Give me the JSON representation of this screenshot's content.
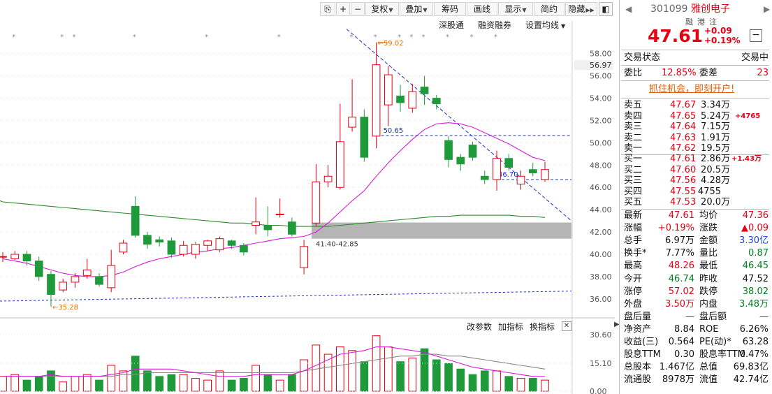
{
  "toolbar": {
    "buttons": [
      {
        "label": "复权",
        "dropdown": true
      },
      {
        "label": "叠加",
        "dropdown": true
      },
      {
        "label": "筹码",
        "dropdown": false
      },
      {
        "label": "画线",
        "dropdown": false
      },
      {
        "label": "显示",
        "dropdown": true
      },
      {
        "label": "简约",
        "dropdown": false
      },
      {
        "label": "隐藏",
        "dropdown": false
      }
    ],
    "shenzhen_link": "深股通",
    "margin_link": "融资融券",
    "ma_settings": "设置均线"
  },
  "price_axis": {
    "ticks": [
      "58.00",
      "56.00",
      "54.00",
      "52.00",
      "50.00",
      "48.00",
      "46.00",
      "44.00",
      "42.00",
      "40.00",
      "38.00",
      "36.00"
    ],
    "current_marker": "56.97"
  },
  "annotations": {
    "high_label": "59.02",
    "low_label": "35.28",
    "line_label_1": "50.65",
    "line_label_2": "46.70",
    "zone_label": "41.40-42.85"
  },
  "volume": {
    "params_link": "改参数",
    "add_indicator": "加指标",
    "switch_indicator": "换指标",
    "close": "✕",
    "axis_ticks": [
      "30.60",
      "15.10",
      "0.00"
    ]
  },
  "chart_data": {
    "type": "candlestick",
    "price_range": [
      35,
      59
    ],
    "volume_range": [
      0,
      31
    ],
    "candles": [
      {
        "o": 39.8,
        "c": 39.8,
        "h": 40.2,
        "l": 39.3,
        "v": 8
      },
      {
        "o": 39.6,
        "c": 40.0,
        "h": 40.3,
        "l": 39.5,
        "v": 9
      },
      {
        "o": 40.0,
        "c": 39.4,
        "h": 40.3,
        "l": 39.0,
        "v": 6
      },
      {
        "o": 39.4,
        "c": 38.0,
        "h": 39.8,
        "l": 37.6,
        "v": 8
      },
      {
        "o": 38.2,
        "c": 36.4,
        "h": 38.5,
        "l": 35.3,
        "v": 11
      },
      {
        "o": 36.8,
        "c": 37.5,
        "h": 37.8,
        "l": 36.6,
        "v": 5
      },
      {
        "o": 37.5,
        "c": 38.0,
        "h": 38.3,
        "l": 37.0,
        "v": 8
      },
      {
        "o": 38.1,
        "c": 38.6,
        "h": 39.6,
        "l": 37.8,
        "v": 9
      },
      {
        "o": 38.0,
        "c": 37.3,
        "h": 38.3,
        "l": 37.1,
        "v": 6
      },
      {
        "o": 37.0,
        "c": 39.0,
        "h": 40.4,
        "l": 36.6,
        "v": 14
      },
      {
        "o": 40.2,
        "c": 41.0,
        "h": 41.3,
        "l": 40.0,
        "v": 11
      },
      {
        "o": 44.3,
        "c": 41.7,
        "h": 45.2,
        "l": 41.5,
        "v": 19
      },
      {
        "o": 41.7,
        "c": 40.9,
        "h": 42.0,
        "l": 40.5,
        "v": 11
      },
      {
        "o": 41.3,
        "c": 41.1,
        "h": 41.6,
        "l": 40.7,
        "v": 8
      },
      {
        "o": 41.2,
        "c": 40.0,
        "h": 41.5,
        "l": 39.7,
        "v": 9
      },
      {
        "o": 40.0,
        "c": 40.8,
        "h": 41.2,
        "l": 39.8,
        "v": 9
      },
      {
        "o": 40.0,
        "c": 40.9,
        "h": 41.1,
        "l": 39.6,
        "v": 7
      },
      {
        "o": 40.8,
        "c": 41.2,
        "h": 41.3,
        "l": 40.3,
        "v": 6
      },
      {
        "o": 40.4,
        "c": 41.4,
        "h": 41.6,
        "l": 40.2,
        "v": 11
      },
      {
        "o": 41.2,
        "c": 40.8,
        "h": 41.3,
        "l": 40.5,
        "v": 6
      },
      {
        "o": 40.8,
        "c": 40.2,
        "h": 41.0,
        "l": 39.9,
        "v": 7
      },
      {
        "o": 42.6,
        "c": 42.9,
        "h": 45.1,
        "l": 41.8,
        "v": 14
      },
      {
        "o": 42.6,
        "c": 42.2,
        "h": 44.3,
        "l": 41.6,
        "v": 9
      },
      {
        "o": 43.6,
        "c": 43.6,
        "h": 45.0,
        "l": 43.3,
        "v": 6
      },
      {
        "o": 42.9,
        "c": 41.8,
        "h": 43.3,
        "l": 41.6,
        "v": 9
      },
      {
        "o": 38.8,
        "c": 40.7,
        "h": 41.3,
        "l": 38.2,
        "v": 17
      },
      {
        "o": 42.8,
        "c": 46.5,
        "h": 48.1,
        "l": 42.5,
        "v": 25
      },
      {
        "o": 46.5,
        "c": 47.0,
        "h": 48.0,
        "l": 46.0,
        "v": 20
      },
      {
        "o": 46.0,
        "c": 50.1,
        "h": 53.5,
        "l": 45.8,
        "v": 24
      },
      {
        "o": 51.4,
        "c": 52.3,
        "h": 55.7,
        "l": 51.0,
        "v": 22
      },
      {
        "o": 52.3,
        "c": 48.7,
        "h": 53.0,
        "l": 48.3,
        "v": 16
      },
      {
        "o": 50.6,
        "c": 57.0,
        "h": 59.0,
        "l": 49.5,
        "v": 30
      },
      {
        "o": 53.4,
        "c": 56.1,
        "h": 56.9,
        "l": 51.5,
        "v": 24
      },
      {
        "o": 54.2,
        "c": 53.6,
        "h": 55.2,
        "l": 52.8,
        "v": 16
      },
      {
        "o": 53.1,
        "c": 54.6,
        "h": 55.3,
        "l": 52.7,
        "v": 18
      },
      {
        "o": 55.0,
        "c": 54.4,
        "h": 56.0,
        "l": 53.4,
        "v": 23
      },
      {
        "o": 54.0,
        "c": 53.5,
        "h": 54.3,
        "l": 53.0,
        "v": 17
      },
      {
        "o": 50.2,
        "c": 48.5,
        "h": 50.6,
        "l": 47.8,
        "v": 15
      },
      {
        "o": 48.7,
        "c": 48.1,
        "h": 49.0,
        "l": 47.5,
        "v": 12
      },
      {
        "o": 49.8,
        "c": 48.7,
        "h": 50.1,
        "l": 48.4,
        "v": 9
      },
      {
        "o": 47.0,
        "c": 46.7,
        "h": 47.5,
        "l": 46.3,
        "v": 11
      },
      {
        "o": 46.7,
        "c": 48.6,
        "h": 49.3,
        "l": 45.7,
        "v": 11
      },
      {
        "o": 48.6,
        "c": 47.8,
        "h": 49.0,
        "l": 47.5,
        "v": 8
      },
      {
        "o": 46.3,
        "c": 47.0,
        "h": 47.5,
        "l": 45.8,
        "v": 7
      },
      {
        "o": 47.6,
        "c": 47.3,
        "h": 48.2,
        "l": 47.0,
        "v": 7
      },
      {
        "o": 46.7,
        "c": 47.6,
        "h": 48.3,
        "l": 46.5,
        "v": 6
      }
    ],
    "ma_short": [
      39.6,
      39.4,
      39.2,
      38.9,
      38.6,
      38.3,
      38.1,
      38.0,
      38.0,
      38.1,
      38.4,
      38.9,
      39.3,
      39.6,
      39.8,
      40.0,
      40.2,
      40.3,
      40.5,
      40.6,
      40.8,
      41.0,
      41.2,
      41.4,
      41.5,
      41.6,
      42.0,
      42.8,
      43.8,
      44.8,
      45.7,
      47.0,
      48.2,
      49.3,
      50.3,
      51.2,
      51.7,
      51.8,
      51.7,
      51.4,
      50.9,
      50.4,
      49.9,
      49.3,
      48.7,
      48.4
    ],
    "ma_long": [
      44.7,
      44.6,
      44.5,
      44.4,
      44.3,
      44.2,
      44.1,
      44.0,
      43.9,
      43.8,
      43.7,
      43.6,
      43.5,
      43.4,
      43.3,
      43.2,
      43.1,
      43.0,
      42.9,
      42.8,
      42.8,
      42.7,
      42.6,
      42.6,
      42.5,
      42.5,
      42.5,
      42.5,
      42.6,
      42.7,
      42.8,
      42.9,
      43.0,
      43.1,
      43.2,
      43.3,
      43.4,
      43.4,
      43.5,
      43.5,
      43.5,
      43.5,
      43.5,
      43.4,
      43.4,
      43.3
    ],
    "vol_ma_short": [
      8,
      8,
      8,
      8,
      9,
      8,
      8,
      8,
      8,
      9,
      10,
      12,
      12,
      12,
      12,
      11,
      10,
      9,
      8,
      8,
      8,
      9,
      9,
      9,
      9,
      11,
      14,
      17,
      20,
      21,
      22,
      24,
      24,
      23,
      22,
      21,
      19,
      17,
      15,
      13,
      12,
      11,
      10,
      9,
      8,
      8
    ],
    "vol_ma_long": [
      8,
      8,
      8,
      8,
      8,
      8,
      8,
      8,
      8,
      8,
      9,
      9,
      10,
      10,
      10,
      10,
      10,
      10,
      10,
      10,
      10,
      10,
      10,
      10,
      10,
      11,
      12,
      13,
      14,
      15,
      16,
      17,
      18,
      19,
      19,
      20,
      20,
      19,
      19,
      18,
      17,
      16,
      15,
      14,
      13,
      12
    ]
  },
  "quote": {
    "code": "301099",
    "name": "雅创电子",
    "tags": [
      "融",
      "港",
      "注"
    ],
    "price": "47.61",
    "change": "+0.09",
    "change_pct": "+0.19%",
    "collapse": "−",
    "trade_status_label": "交易状态",
    "trade_status_value": "交易中",
    "weibi_label": "委比",
    "weibi_value": "12.85%",
    "weicha_label": "委差",
    "weicha_value": "23",
    "promo": "抓住机会，即刻开户!",
    "asks": [
      {
        "label": "卖五",
        "price": "47.67",
        "vol": "3.34",
        "unit": "万",
        "extra": ""
      },
      {
        "label": "卖四",
        "price": "47.65",
        "vol": "5.24",
        "unit": "万",
        "extra": "+4765"
      },
      {
        "label": "卖三",
        "price": "47.64",
        "vol": "7.15",
        "unit": "万",
        "extra": ""
      },
      {
        "label": "卖二",
        "price": "47.63",
        "vol": "1.91",
        "unit": "万",
        "extra": ""
      },
      {
        "label": "卖一",
        "price": "47.62",
        "vol": "19.5",
        "unit": "万",
        "extra": ""
      }
    ],
    "bids": [
      {
        "label": "买一",
        "price": "47.61",
        "vol": "2.86",
        "unit": "万",
        "extra": "+1.43万"
      },
      {
        "label": "买二",
        "price": "47.60",
        "vol": "20.5",
        "unit": "万",
        "extra": ""
      },
      {
        "label": "买三",
        "price": "47.56",
        "vol": "4.28",
        "unit": "万",
        "extra": ""
      },
      {
        "label": "买四",
        "price": "47.55",
        "vol": "4755",
        "unit": "",
        "extra": ""
      },
      {
        "label": "买五",
        "price": "47.53",
        "vol": "20.0",
        "unit": "万",
        "extra": ""
      }
    ],
    "stats": [
      {
        "l1": "最新",
        "v1": "47.61",
        "c1": "red",
        "l2": "均价",
        "v2": "47.36",
        "c2": "red"
      },
      {
        "l1": "涨幅",
        "v1": "+0.19%",
        "c1": "red",
        "l2": "涨跌",
        "v2": "▲0.09",
        "c2": "red"
      },
      {
        "l1": "总手",
        "v1": "6.97万",
        "c1": "blk",
        "l2": "金额",
        "v2": "3.30亿",
        "c2": "blu"
      },
      {
        "l1": "换手*",
        "v1": "7.77%",
        "c1": "blk",
        "l2": "量比",
        "v2": "0.87",
        "c2": "grn"
      },
      {
        "l1": "最高",
        "v1": "48.26",
        "c1": "red",
        "l2": "最低",
        "v2": "46.45",
        "c2": "grn"
      },
      {
        "l1": "今开",
        "v1": "46.74",
        "c1": "grn",
        "l2": "昨收",
        "v2": "47.52",
        "c2": "blk"
      },
      {
        "l1": "涨停",
        "v1": "57.02",
        "c1": "red",
        "l2": "跌停",
        "v2": "38.02",
        "c2": "grn"
      },
      {
        "l1": "外盘",
        "v1": "3.50万",
        "c1": "red",
        "l2": "内盘",
        "v2": "3.48万",
        "c2": "grn"
      },
      {
        "l1": "盘后量",
        "v1": "—",
        "c1": "blu",
        "l2": "盘后额",
        "v2": "—",
        "c2": "blu"
      },
      {
        "l1": "净资产",
        "v1": "8.84",
        "c1": "blk",
        "l2": "ROE",
        "v2": "6.26%",
        "c2": "blk"
      },
      {
        "l1": "收益(三)",
        "v1": "0.564",
        "c1": "blk",
        "l2": "PE(动)*",
        "v2": "63.28",
        "c2": "blk"
      },
      {
        "l1": "股息TTM",
        "v1": "0.30",
        "c1": "blk",
        "l2": "股息率TTM",
        "v2": "0.47%",
        "c2": "blk"
      },
      {
        "l1": "总股本",
        "v1": "1.467亿",
        "c1": "blk",
        "l2": "总值",
        "v2": "69.83亿",
        "c2": "blk"
      },
      {
        "l1": "流通股",
        "v1": "8978万",
        "c1": "blk",
        "l2": "流值",
        "v2": "42.74亿",
        "c2": "blk"
      }
    ]
  },
  "colors": {
    "up": "#e60012",
    "down": "#1f9a3a",
    "ma_short": "#d81bd8",
    "ma_long": "#2e8b2e",
    "trend_blue": "#1a2fd0",
    "zone": "#a9a9a9"
  }
}
